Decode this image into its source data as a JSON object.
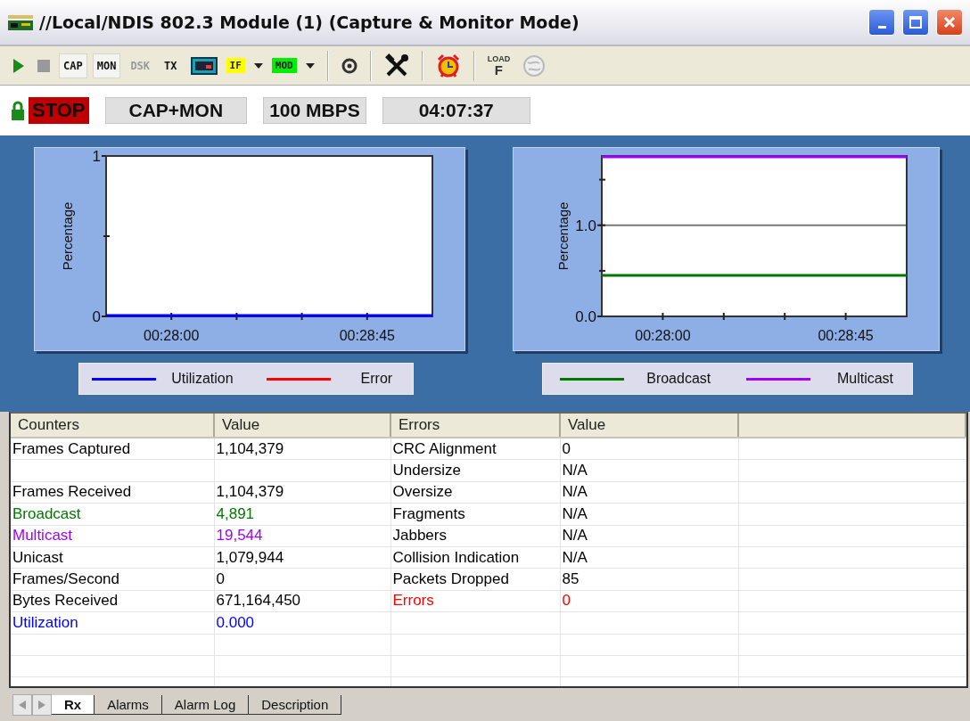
{
  "window": {
    "title": "//Local/NDIS 802.3 Module (1) (Capture & Monitor Mode)"
  },
  "toolbar": {
    "mode_buttons": [
      {
        "label": "CAP",
        "selected": true,
        "disabled": false
      },
      {
        "label": "MON",
        "selected": true,
        "disabled": false
      },
      {
        "label": "DSK",
        "selected": false,
        "disabled": true
      },
      {
        "label": "TX",
        "selected": false,
        "disabled": false
      }
    ],
    "filters": [
      {
        "label": "IF",
        "color": "#ffff00"
      },
      {
        "label": "MOD",
        "color": "#00ee00"
      }
    ],
    "load_button": {
      "label_top": "LOAD",
      "label_bottom": "F"
    }
  },
  "status": {
    "state": "STOP",
    "mode": "CAP+MON",
    "speed": "100 MBPS",
    "elapsed": "04:07:37"
  },
  "charts": [
    {
      "chart_data": {
        "type": "line",
        "ylabel": "Percentage",
        "categories": [
          null,
          "00:28:00",
          null,
          null,
          "00:28:45",
          null
        ],
        "ylim": [
          0,
          1
        ],
        "yticks": [
          0,
          1
        ],
        "series": [
          {
            "name": "Utilization",
            "color": "#0000ff",
            "values": [
              0,
              0,
              0,
              0,
              0,
              0
            ]
          },
          {
            "name": "Error",
            "color": "#ff0000",
            "values": [
              null,
              null,
              null,
              null,
              null,
              null
            ]
          }
        ]
      }
    },
    {
      "chart_data": {
        "type": "line",
        "ylabel": "Percentage",
        "categories": [
          null,
          "00:28:00",
          null,
          null,
          "00:28:45",
          null
        ],
        "ylim": [
          0,
          1.76
        ],
        "yticks": [
          {
            "value": 0,
            "label": "0.0"
          },
          {
            "value": 1,
            "label": "1.0"
          }
        ],
        "series": [
          {
            "name": "Broadcast",
            "color": "#007700",
            "values": [
              0.45,
              0.45,
              0.45,
              0.45,
              0.45,
              0.45
            ]
          },
          {
            "name": "Multicast",
            "color": "#a000ff",
            "values": [
              1.75,
              1.75,
              1.75,
              1.75,
              1.75,
              1.75
            ]
          }
        ]
      }
    }
  ],
  "table": {
    "columns": [
      "Counters",
      "Value",
      "Errors",
      "Value"
    ],
    "rows": [
      {
        "counter": {
          "label": "Frames Captured",
          "value": "1,104,379",
          "color": "#000000"
        },
        "error": {
          "label": "CRC Alignment",
          "value": "0",
          "color": "#000000"
        }
      },
      {
        "error": {
          "label": "Undersize",
          "value": "N/A",
          "color": "#000000"
        }
      },
      {
        "counter": {
          "label": "Frames Received",
          "value": "1,104,379",
          "color": "#000000"
        },
        "error": {
          "label": "Oversize",
          "value": "N/A",
          "color": "#000000"
        }
      },
      {
        "counter": {
          "label": "Broadcast",
          "value": "4,891",
          "color": "#007700"
        },
        "error": {
          "label": "Fragments",
          "value": "N/A",
          "color": "#000000"
        }
      },
      {
        "counter": {
          "label": "Multicast",
          "value": "19,544",
          "color": "#a000ff"
        },
        "error": {
          "label": "Jabbers",
          "value": "N/A",
          "color": "#000000"
        }
      },
      {
        "counter": {
          "label": "Unicast",
          "value": "1,079,944",
          "color": "#000000"
        },
        "error": {
          "label": "Collision Indication",
          "value": "N/A",
          "color": "#000000"
        }
      },
      {
        "counter": {
          "label": "Frames/Second",
          "value": "0",
          "color": "#000000"
        },
        "error": {
          "label": "Packets Dropped",
          "value": "85",
          "color": "#000000"
        }
      },
      {
        "counter": {
          "label": "Bytes Received",
          "value": "671,164,450",
          "color": "#000000"
        },
        "error": {
          "label": "Errors",
          "value": "0",
          "color": "#ff0000"
        }
      },
      {
        "counter": {
          "label": "Utilization",
          "value": "0.000",
          "color": "#0000ff"
        }
      }
    ]
  },
  "tabs": [
    {
      "label": "Rx",
      "selected": true
    },
    {
      "label": "Alarms",
      "selected": false
    },
    {
      "label": "Alarm Log",
      "selected": false
    },
    {
      "label": "Description",
      "selected": false
    }
  ]
}
